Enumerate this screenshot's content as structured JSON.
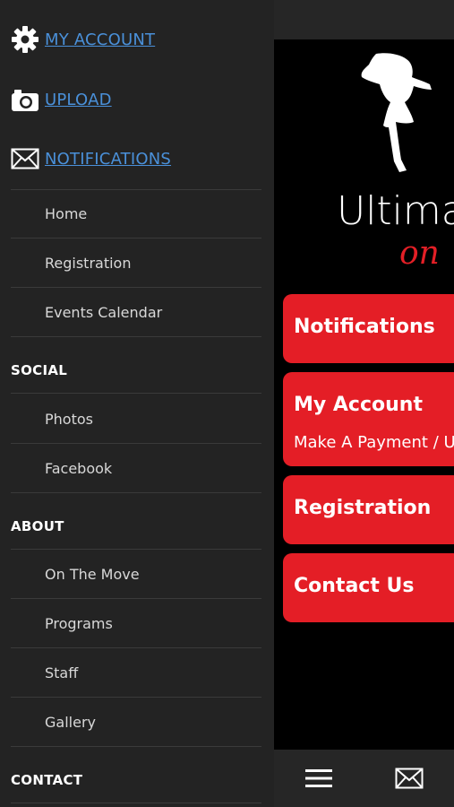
{
  "drawer": {
    "top_links": [
      {
        "label": "MY ACCOUNT",
        "icon": "gear-icon"
      },
      {
        "label": "UPLOAD",
        "icon": "camera-icon"
      },
      {
        "label": "NOTIFICATIONS",
        "icon": "envelope-icon"
      }
    ],
    "main_items": [
      "Home",
      "Registration",
      "Events Calendar"
    ],
    "sections": [
      {
        "heading": "SOCIAL",
        "items": [
          "Photos",
          "Facebook"
        ]
      },
      {
        "heading": "ABOUT",
        "items": [
          "On The Move",
          "Programs",
          "Staff",
          "Gallery"
        ]
      },
      {
        "heading": "CONTACT",
        "items": []
      }
    ]
  },
  "main": {
    "brand_title": "Ultima",
    "brand_sub": "on",
    "cards": [
      {
        "title": "Notifications",
        "subtitle": ""
      },
      {
        "title": "My Account",
        "subtitle": "Make A Payment / U"
      },
      {
        "title": "Registration",
        "subtitle": ""
      },
      {
        "title": "Contact Us",
        "subtitle": ""
      }
    ],
    "bottom_bar": {
      "icons": [
        "menu-icon",
        "envelope-icon"
      ]
    }
  },
  "colors": {
    "accent_red": "#e41e26",
    "link_blue": "#4a90d9",
    "drawer_bg": "#232323"
  }
}
